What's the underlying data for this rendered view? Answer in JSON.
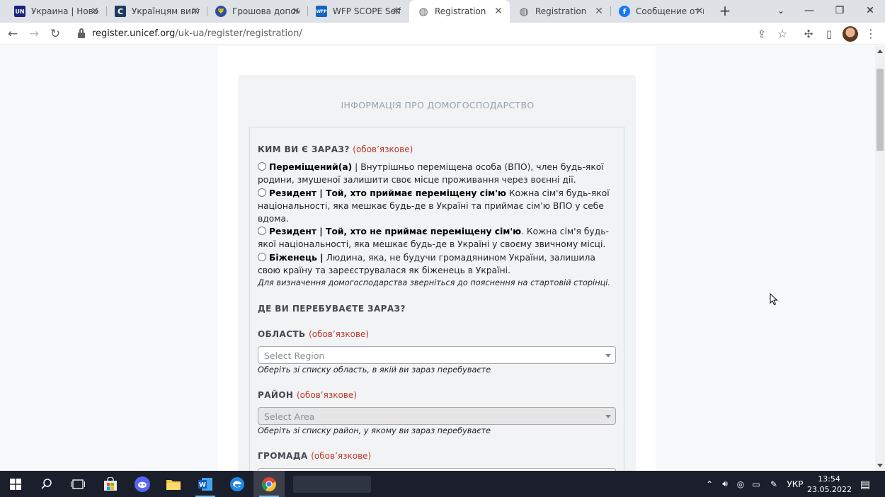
{
  "browser": {
    "tabs": [
      {
        "title": "Украина | Новост",
        "favicon": "un-icon",
        "color": "#1a237e",
        "glyph": "UN"
      },
      {
        "title": "Українцям випла",
        "favicon": "c-logo-icon",
        "color": "#1e3a5f",
        "glyph": "C"
      },
      {
        "title": "Грошова допомо",
        "favicon": "trident-icon",
        "color": "#2a4fa0",
        "glyph": "Ψ"
      },
      {
        "title": "WFP SCOPE Self R",
        "favicon": "wfp-icon",
        "color": "#1565c0",
        "glyph": "WFP"
      },
      {
        "title": "Registration",
        "favicon": "globe-icon",
        "color": "#5f6368",
        "glyph": "◍"
      },
      {
        "title": "Registration",
        "favicon": "globe-icon",
        "color": "#5f6368",
        "glyph": "◍"
      },
      {
        "title": "Сообщение от п",
        "favicon": "facebook-icon",
        "color": "#1877f2",
        "glyph": "f"
      }
    ],
    "active_tab": 4,
    "url_host": "register.unicef.org",
    "url_path": "/uk-ua/register/registration/"
  },
  "form": {
    "section_title": "ІНФОРМАЦІЯ ПРО ДОМОГОСПОДАРСТВО",
    "required_text": "(обов’язкове)",
    "who_label": "КИМ ВИ Є ЗАРАЗ?",
    "options": [
      {
        "bold": "Переміщений(а)",
        "text": " | Внутрішньо переміщена особа (ВПО), член будь-якої родини, змушеної залишити своє місце проживання через воєнні дії."
      },
      {
        "bold": "Резидент | Той, хто приймає переміщену сім'ю",
        "text": " Кожна сім'я будь-якої національності, яка мешкає будь-де в Україні та приймає сім’ю ВПО у себе вдома."
      },
      {
        "bold": "Резидент | Той, хто не приймає переміщену сім'ю",
        "text": ". Кожна сім'я будь-якої національності, яка мешкає будь-де в Україні у своєму звичному місці."
      },
      {
        "bold": "Біженець |",
        "text": " Людина, яка, не будучи громадянином України, залишила свою країну та зареєструвалася як біженець в Україні."
      }
    ],
    "household_hint": "Для визначення домогосподарства зверніться до пояснення на стартовій сторінці.",
    "where_label": "ДЕ ВИ ПЕРЕБУВАЄТЕ ЗАРАЗ?",
    "region_label": "ОБЛАСТЬ",
    "region_placeholder": "Select Region",
    "region_hint": "Оберіть зі списку область, в якій ви зараз перебуваєте",
    "area_label": "РАЙОН",
    "area_placeholder": "Select Area",
    "area_hint": "Оберіть зі списку район, у якому ви зараз перебуваєте",
    "community_label": "ГРОМАДА"
  },
  "taskbar": {
    "language": "УКР",
    "time": "13:54",
    "date": "23.05.2022"
  }
}
